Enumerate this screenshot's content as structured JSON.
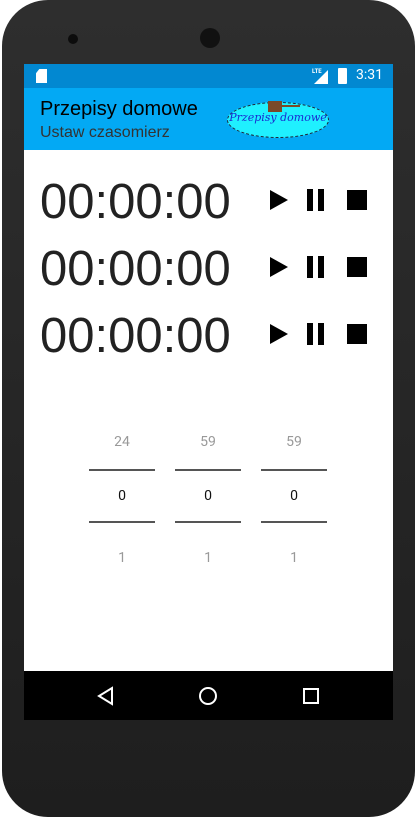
{
  "status_bar": {
    "time": "3:31",
    "network": "LTE"
  },
  "toolbar": {
    "title": "Przepisy domowe",
    "subtitle": "Ustaw czasomierz",
    "logo_text": "Przepisy domowe"
  },
  "timers": [
    {
      "value": "00:00:00"
    },
    {
      "value": "00:00:00"
    },
    {
      "value": "00:00:00"
    }
  ],
  "pickers": [
    {
      "prev": "24",
      "current": "0",
      "next": "1"
    },
    {
      "prev": "59",
      "current": "0",
      "next": "1"
    },
    {
      "prev": "59",
      "current": "0",
      "next": "1"
    }
  ],
  "colors": {
    "status": "#0288D1",
    "toolbar": "#03A9F4"
  }
}
